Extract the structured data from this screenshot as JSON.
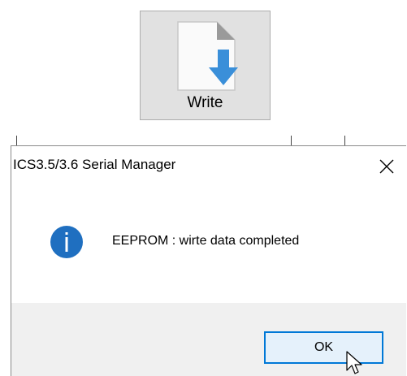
{
  "toolbar": {
    "write_label": "Write",
    "write_icon": "document-download-icon"
  },
  "dialog": {
    "title": "ICS3.5/3.6 Serial Manager",
    "close_icon": "close-icon",
    "icon": "information-icon",
    "message": "EEPROM : wirte data completed",
    "ok_label": "OK"
  },
  "colors": {
    "info_blue": "#1f6fc0",
    "arrow_blue": "#3a8fd9",
    "ok_border": "#0078d7",
    "ok_fill": "#e5f1fb",
    "footer_bg": "#f0f0f0",
    "toolbar_button_bg": "#e1e1e1"
  }
}
